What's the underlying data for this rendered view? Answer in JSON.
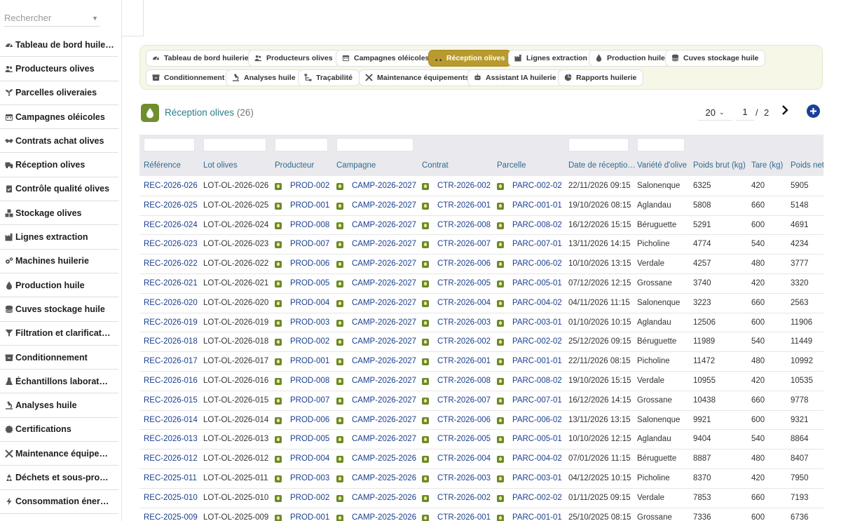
{
  "search": {
    "placeholder": "Rechercher"
  },
  "sidebar": {
    "items": [
      {
        "label": "Tableau de bord huile…",
        "icon": "gauge-icon"
      },
      {
        "label": "Producteurs olives",
        "icon": "users-icon"
      },
      {
        "label": "Parcelles oliveraies",
        "icon": "seedling-icon"
      },
      {
        "label": "Campagnes oléicoles",
        "icon": "calendar-icon"
      },
      {
        "label": "Contrats achat olives",
        "icon": "handshake-icon"
      },
      {
        "label": "Réception olives",
        "icon": "truck-icon"
      },
      {
        "label": "Contrôle qualité olives",
        "icon": "clipboard-check-icon"
      },
      {
        "label": "Stockage olives",
        "icon": "boxes-icon"
      },
      {
        "label": "Lignes extraction",
        "icon": "industry-icon"
      },
      {
        "label": "Machines huilerie",
        "icon": "cogs-icon"
      },
      {
        "label": "Production huile",
        "icon": "oil-drop-icon"
      },
      {
        "label": "Cuves stockage huile",
        "icon": "database-icon"
      },
      {
        "label": "Filtration et clarificat…",
        "icon": "filter-icon"
      },
      {
        "label": "Conditionnement",
        "icon": "box-icon"
      },
      {
        "label": "Échantillons laborat…",
        "icon": "flask-icon"
      },
      {
        "label": "Analyses huile",
        "icon": "microscope-icon"
      },
      {
        "label": "Certifications",
        "icon": "certificate-icon"
      },
      {
        "label": "Maintenance équipe…",
        "icon": "tools-icon"
      },
      {
        "label": "Déchets et sous-pro…",
        "icon": "recycle-icon"
      },
      {
        "label": "Consommation éner…",
        "icon": "bolt-icon"
      }
    ]
  },
  "toolbar": {
    "buttons": [
      {
        "label": "Tableau de bord huilerie",
        "icon": "gauge-icon"
      },
      {
        "label": "Producteurs olives",
        "icon": "users-icon"
      },
      {
        "label": "Campagnes oléicoles",
        "icon": "calendar-icon"
      },
      {
        "label": "Réception olives",
        "icon": "truck-icon",
        "active": true
      },
      {
        "label": "Lignes extraction",
        "icon": "industry-icon"
      },
      {
        "label": "Production huile",
        "icon": "oil-drop-icon"
      },
      {
        "label": "Cuves stockage huile",
        "icon": "database-icon"
      },
      {
        "label": "Conditionnement",
        "icon": "box-icon"
      },
      {
        "label": "Analyses huile",
        "icon": "microscope-icon"
      },
      {
        "label": "Traçabilité",
        "icon": "sitemap-icon"
      },
      {
        "label": "Maintenance équipements",
        "icon": "tools-icon"
      },
      {
        "label": "Assistant IA huilerie",
        "icon": "robot-icon"
      },
      {
        "label": "Rapports huilerie",
        "icon": "chart-pie-icon"
      }
    ]
  },
  "header": {
    "title": "Réception olives",
    "count": "(26)",
    "page_size": "20",
    "page": "1",
    "slash": "/",
    "total_pages": "2"
  },
  "colors": {
    "accent": "#b89a2d",
    "link": "#1b3f8f",
    "header_text": "#2f6c8c",
    "primary": "#1b3f9a"
  },
  "table": {
    "columns": [
      "Référence",
      "Lot olives",
      "Producteur",
      "Campagne",
      "Contrat",
      "Parcelle",
      "Date de réceptio…",
      "Variété d'olive",
      "Poids brut (kg)",
      "Tare (kg)",
      "Poids net"
    ],
    "rows": [
      [
        "REC-2026-026",
        "LOT-OL-2026-026",
        "PROD-002",
        "CAMP-2026-2027",
        "CTR-2026-002",
        "PARC-002-02",
        "22/11/2026 09:15",
        "Salonenque",
        "6325",
        "420",
        "5905"
      ],
      [
        "REC-2026-025",
        "LOT-OL-2026-025",
        "PROD-001",
        "CAMP-2026-2027",
        "CTR-2026-001",
        "PARC-001-01",
        "19/10/2026 08:15",
        "Aglandau",
        "5808",
        "660",
        "5148"
      ],
      [
        "REC-2026-024",
        "LOT-OL-2026-024",
        "PROD-008",
        "CAMP-2026-2027",
        "CTR-2026-008",
        "PARC-008-02",
        "16/12/2026 15:15",
        "Béruguette",
        "5291",
        "600",
        "4691"
      ],
      [
        "REC-2026-023",
        "LOT-OL-2026-023",
        "PROD-007",
        "CAMP-2026-2027",
        "CTR-2026-007",
        "PARC-007-01",
        "13/11/2026 14:15",
        "Picholine",
        "4774",
        "540",
        "4234"
      ],
      [
        "REC-2026-022",
        "LOT-OL-2026-022",
        "PROD-006",
        "CAMP-2026-2027",
        "CTR-2026-006",
        "PARC-006-02",
        "10/10/2026 13:15",
        "Verdale",
        "4257",
        "480",
        "3777"
      ],
      [
        "REC-2026-021",
        "LOT-OL-2026-021",
        "PROD-005",
        "CAMP-2026-2027",
        "CTR-2026-005",
        "PARC-005-01",
        "07/12/2026 12:15",
        "Grossane",
        "3740",
        "420",
        "3320"
      ],
      [
        "REC-2026-020",
        "LOT-OL-2026-020",
        "PROD-004",
        "CAMP-2026-2027",
        "CTR-2026-004",
        "PARC-004-02",
        "04/11/2026 11:15",
        "Salonenque",
        "3223",
        "660",
        "2563"
      ],
      [
        "REC-2026-019",
        "LOT-OL-2026-019",
        "PROD-003",
        "CAMP-2026-2027",
        "CTR-2026-003",
        "PARC-003-01",
        "01/10/2026 10:15",
        "Aglandau",
        "12506",
        "600",
        "11906"
      ],
      [
        "REC-2026-018",
        "LOT-OL-2026-018",
        "PROD-002",
        "CAMP-2026-2027",
        "CTR-2026-002",
        "PARC-002-02",
        "25/12/2026 09:15",
        "Béruguette",
        "11989",
        "540",
        "11449"
      ],
      [
        "REC-2026-017",
        "LOT-OL-2026-017",
        "PROD-001",
        "CAMP-2026-2027",
        "CTR-2026-001",
        "PARC-001-01",
        "22/11/2026 08:15",
        "Picholine",
        "11472",
        "480",
        "10992"
      ],
      [
        "REC-2026-016",
        "LOT-OL-2026-016",
        "PROD-008",
        "CAMP-2026-2027",
        "CTR-2026-008",
        "PARC-008-02",
        "19/10/2026 15:15",
        "Verdale",
        "10955",
        "420",
        "10535"
      ],
      [
        "REC-2026-015",
        "LOT-OL-2026-015",
        "PROD-007",
        "CAMP-2026-2027",
        "CTR-2026-007",
        "PARC-007-01",
        "16/12/2026 14:15",
        "Grossane",
        "10438",
        "660",
        "9778"
      ],
      [
        "REC-2026-014",
        "LOT-OL-2026-014",
        "PROD-006",
        "CAMP-2026-2027",
        "CTR-2026-006",
        "PARC-006-02",
        "13/11/2026 13:15",
        "Salonenque",
        "9921",
        "600",
        "9321"
      ],
      [
        "REC-2026-013",
        "LOT-OL-2026-013",
        "PROD-005",
        "CAMP-2026-2027",
        "CTR-2026-005",
        "PARC-005-01",
        "10/10/2026 12:15",
        "Aglandau",
        "9404",
        "540",
        "8864"
      ],
      [
        "REC-2026-012",
        "LOT-OL-2026-012",
        "PROD-004",
        "CAMP-2025-2026",
        "CTR-2026-004",
        "PARC-004-02",
        "07/01/2026 11:15",
        "Béruguette",
        "8887",
        "480",
        "8407"
      ],
      [
        "REC-2025-011",
        "LOT-OL-2025-011",
        "PROD-003",
        "CAMP-2025-2026",
        "CTR-2026-003",
        "PARC-003-01",
        "04/12/2025 10:15",
        "Picholine",
        "8370",
        "420",
        "7950"
      ],
      [
        "REC-2025-010",
        "LOT-OL-2025-010",
        "PROD-002",
        "CAMP-2025-2026",
        "CTR-2026-002",
        "PARC-002-02",
        "01/11/2025 09:15",
        "Verdale",
        "7853",
        "660",
        "7193"
      ],
      [
        "REC-2025-009",
        "LOT-OL-2025-009",
        "PROD-001",
        "CAMP-2025-2026",
        "CTR-2026-001",
        "PARC-001-01",
        "25/10/2025 08:15",
        "Grossane",
        "7336",
        "600",
        "6736"
      ]
    ]
  }
}
